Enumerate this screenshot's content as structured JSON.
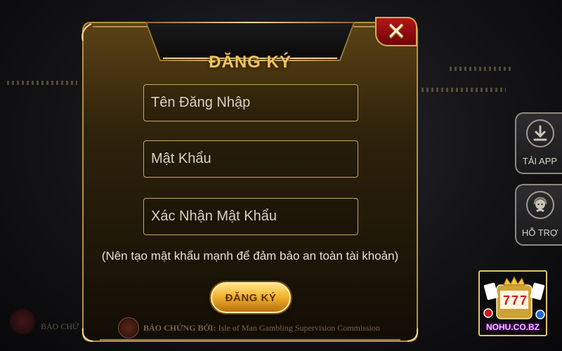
{
  "dialog": {
    "title": "ĐĂNG KÝ",
    "close_label": "✕"
  },
  "form": {
    "username_placeholder": "Tên Đăng Nhập",
    "password_placeholder": "Mật Khẩu",
    "confirm_placeholder": "Xác Nhận Mật Khẩu",
    "hint": "(Nên tạo mật khẩu mạnh để đảm bảo an toàn tài khoản)",
    "submit_label": "ĐĂNG KÝ"
  },
  "footer": {
    "credit_prefix": "BẢO CHỨNG BỞI:",
    "credit_body": " Isle of Man Gambling Supervision Commission",
    "background_credit": "BẢO CHỨ"
  },
  "side_buttons": {
    "download_label": "TẢI APP",
    "download_icon": "download-icon",
    "support_label": "HỖ TRỢ",
    "support_icon": "support-agent-icon"
  },
  "promo": {
    "label": "NOHU.CO.BZ"
  },
  "colors": {
    "gold": "#f2c25e",
    "close_red": "#b4151a",
    "promo_pink": "#f0c0ff"
  }
}
